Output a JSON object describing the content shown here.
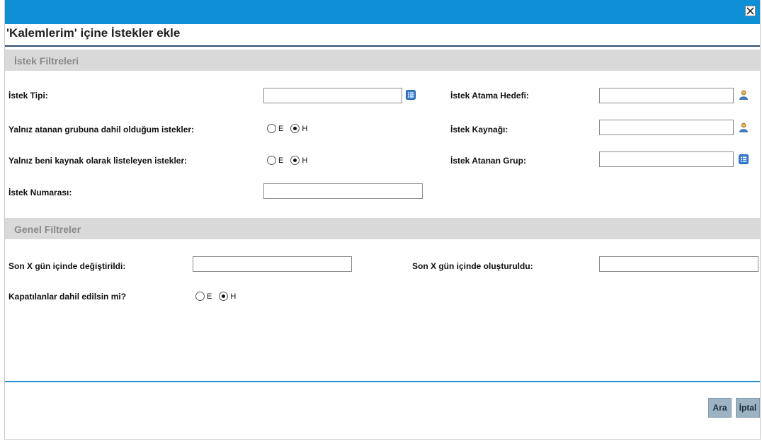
{
  "dialog": {
    "title": "'Kalemlerim' içine İstekler ekle",
    "close_label": "×"
  },
  "request_filters": {
    "heading": "İstek Filtreleri",
    "request_type_label": "İstek Tipi:",
    "assigned_group_only_label": "Yalnız atanan grubuna dahil olduğum istekler:",
    "resource_only_label": "Yalnız beni kaynak olarak listeleyen istekler:",
    "request_number_label": "İstek Numarası:",
    "assign_target_label": "İstek Atama Hedefi:",
    "resource_label": "İstek Kaynağı:",
    "assigned_group_label": "İstek Atanan Grup:",
    "yes": "E",
    "no": "H",
    "request_type_value": "",
    "request_number_value": "",
    "assign_target_value": "",
    "resource_value": "",
    "assigned_group_value": ""
  },
  "general_filters": {
    "heading": "Genel Filtreler",
    "modified_label": "Son X gün içinde değiştirildi:",
    "created_label": "Son X gün içinde oluşturuldu:",
    "include_closed_label": "Kapatılanlar dahil edilsin mi?",
    "yes": "E",
    "no": "H",
    "modified_value": "",
    "created_value": ""
  },
  "footer": {
    "search_label": "Ara",
    "cancel_label": "İptal"
  },
  "icons": {
    "list_picker": "list-icon",
    "user_picker": "user-icon"
  },
  "colors": {
    "accent": "#0f8fd6",
    "section_bg": "#d9d9d9",
    "button_bg": "#9bb3c3"
  }
}
